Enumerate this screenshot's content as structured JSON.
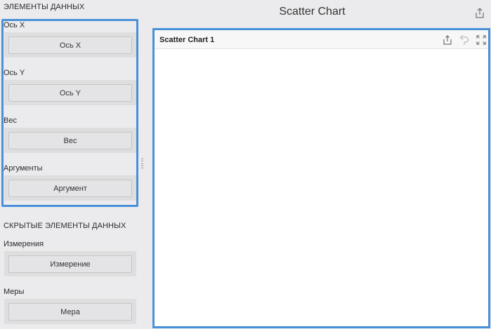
{
  "sidebar": {
    "data_elements_title": "ЭЛЕМЕНТЫ ДАННЫХ",
    "fields": [
      {
        "label": "Ось X",
        "button": "Ось X"
      },
      {
        "label": "Ось Y",
        "button": "Ось Y"
      },
      {
        "label": "Вес",
        "button": "Вес"
      },
      {
        "label": "Аргументы",
        "button": "Аргумент"
      }
    ],
    "hidden_elements_title": "СКРЫТЫЕ ЭЛЕМЕНТЫ ДАННЫХ",
    "hidden_fields": [
      {
        "label": "Измерения",
        "button": "Измерение"
      },
      {
        "label": "Меры",
        "button": "Мера"
      }
    ]
  },
  "header": {
    "title": "Scatter Chart",
    "share_icon": "share-icon"
  },
  "chart_card": {
    "title": "Scatter Chart 1",
    "icons": [
      "share-icon",
      "undo-icon",
      "fullscreen-icon"
    ]
  },
  "colors": {
    "selection_border": "#4a90d9",
    "background": "#ebebed",
    "drop_zone": "#dedede"
  }
}
